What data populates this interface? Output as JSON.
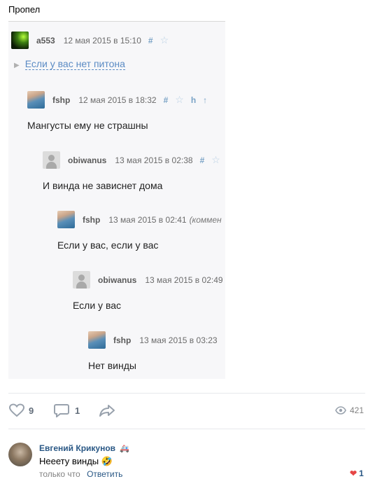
{
  "post": {
    "title": "Пропел"
  },
  "embed": {
    "root": {
      "user": "a553",
      "date": "12 мая 2015 в 15:10",
      "ctl_hash": "#"
    },
    "spoiler": {
      "label": "Если у вас нет питона"
    },
    "comments": [
      {
        "user": "fshp",
        "date": "12 мая 2015 в 18:32",
        "text": "Мангусты ему не страшны",
        "ctl_hash": "#",
        "ctl_h": "h",
        "ctl_up": "↑"
      },
      {
        "user": "obiwanus",
        "date": "13 мая 2015 в 02:38",
        "text": "И винда не зависнет дома",
        "ctl_hash": "#"
      },
      {
        "user": "fshp",
        "date": "13 мая 2015 в 02:41",
        "note": "(коммен",
        "text": "Если у вас, если у вас"
      },
      {
        "user": "obiwanus",
        "date": "13 мая 2015 в 02:49",
        "text": "Если у вас"
      },
      {
        "user": "fshp",
        "date": "13 мая 2015 в 03:23",
        "text": "Нет винды"
      }
    ]
  },
  "actions": {
    "likes": "9",
    "comments": "1",
    "views": "421"
  },
  "comment": {
    "author": "Евгений Крикунов",
    "text": "Нееету винды",
    "time": "только что",
    "reply_label": "Ответить",
    "likes": "1"
  },
  "colors": {
    "link": "#2a5885",
    "like_red": "#e64646",
    "muted": "#828282"
  }
}
